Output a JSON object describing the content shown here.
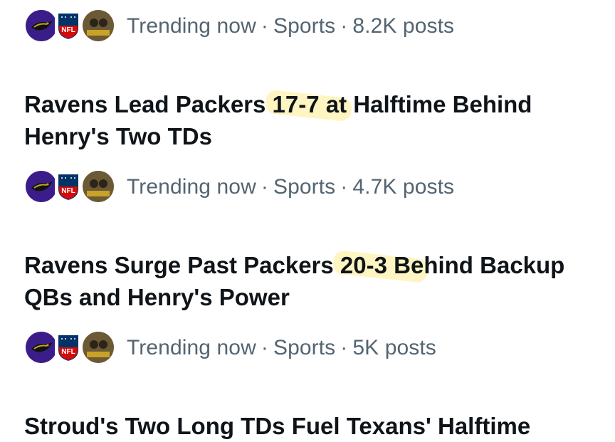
{
  "colors": {
    "meta_text": "#536471",
    "headline_text": "#0f1419",
    "highlight": "#ffe250"
  },
  "trends": [
    {
      "meta": {
        "status": "Trending now",
        "category": "Sports",
        "posts": "8.2K posts"
      },
      "headline": {
        "before": "",
        "mark": "",
        "after": ""
      }
    },
    {
      "headline": {
        "before": "Ravens Lead Packers ",
        "mark": "17-7 at",
        "after": " Halftime Behind",
        "line2": "Henry's Two TDs"
      },
      "meta": {
        "status": "Trending now",
        "category": "Sports",
        "posts": "4.7K posts"
      }
    },
    {
      "headline": {
        "before": "Ravens Surge Past Packers ",
        "mark": "20-3 Be",
        "after": "hind Backup",
        "line2": "QBs and Henry's Power"
      },
      "meta": {
        "status": "Trending now",
        "category": "Sports",
        "posts": "5K posts"
      }
    },
    {
      "headline": {
        "before": "Stroud's Two Long TDs Fuel Texans' Halftime",
        "mark": "",
        "after": "",
        "line2": ""
      }
    }
  ],
  "icons": {
    "ravens": "ravens-logo-icon",
    "nfl": "nfl-shield-icon",
    "fan": "fan-avatar-icon"
  }
}
